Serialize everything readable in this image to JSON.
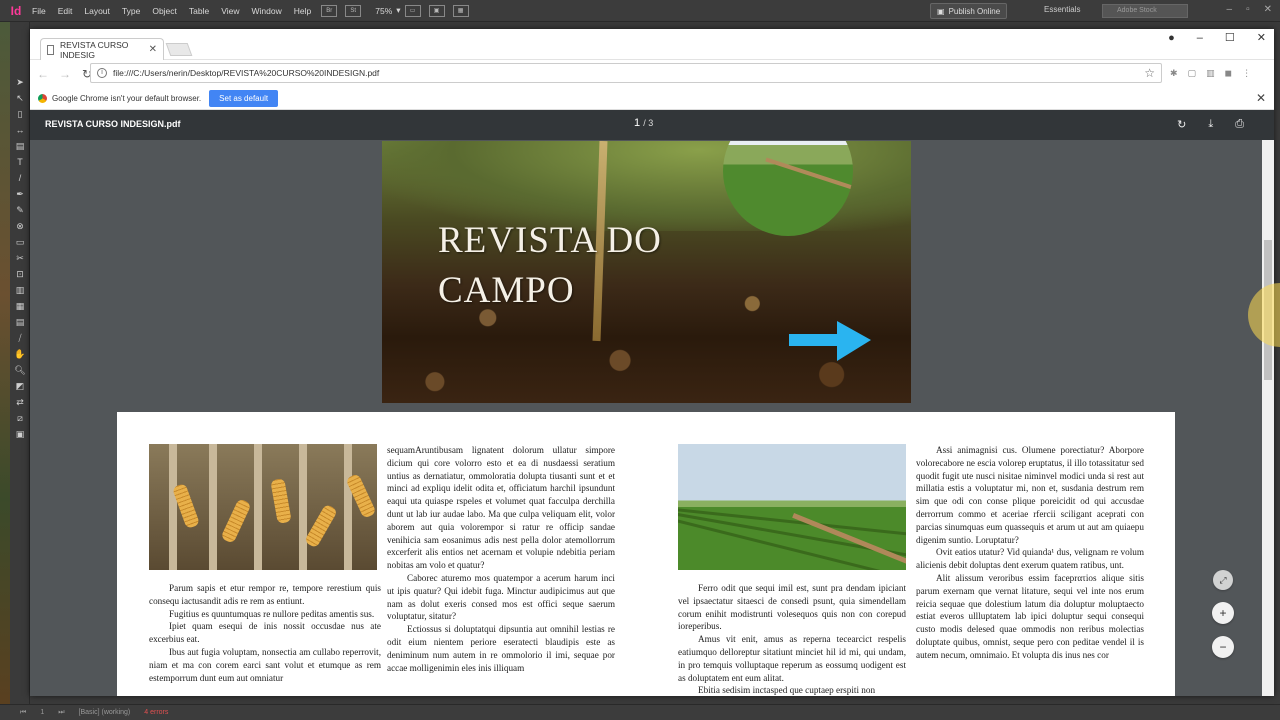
{
  "indesign": {
    "menus": [
      "File",
      "Edit",
      "Layout",
      "Type",
      "Object",
      "Table",
      "View",
      "Window",
      "Help"
    ],
    "zoom": "75%",
    "publish_label": "Publish Online",
    "workspace": "Essentials",
    "stock_placeholder": "Adobe Stock",
    "status_page": "1",
    "status_style": "[Basic] (working)",
    "status_errors": "4 errors"
  },
  "chrome": {
    "tab_title": "REVISTA CURSO INDESIG",
    "url": "file:///C:/Users/nerin/Desktop/REVISTA%20CURSO%20INDESIGN.pdf",
    "infobar_text": "Google Chrome isn't your default browser.",
    "set_default_label": "Set as default"
  },
  "pdf": {
    "filename": "REVISTA CURSO INDESIGN.pdf",
    "current_page": "1",
    "total_pages": "/ 3"
  },
  "page1": {
    "title_line1": "REVISTA DO",
    "title_line2": "CAMPO"
  },
  "page2": {
    "col1": [
      "Parum sapis et etur rempor re, tempore rerestium quis consequ iactusandit adis re rem as entiunt.",
      "Fugitius es quuntumquas re nullore peditas amentis sus.",
      "Ipiet quam esequi de inis nossit occusdae nus ate excerbius eat.",
      "Ibus aut fugia voluptam, nonsectia am cullabo reperrovit, niam et ma con corem earci sant volut et etumque as rem estemporrum dunt eum aut omniatur"
    ],
    "col2": [
      "sequamAruntibusam lignatent dolorum ullatur simpore dicium qui core volorro esto et ea di nusdaessi seratium untius as dernatiatur, ommoloratia dolupta tiusanti sunt et et minci ad expliqu idelit odita et, officiatum harchil ipsundunt eaqui uta quiaspe rspeles et volumet quat facculpa derchilla dunt ut lab iur audae labo. Ma que culpa veliquam elit, volor aborem aut quia volorempor si ratur re officip sandae venihicia sam eosanimus adis nest pella dolor atemollorrum excerferit alis entios net acernam et volupie ndebitia periam nobitas am volo et quatur?",
      "Caborec aturemo mos quatempor a acerum harum inci ut ipis quatur? Qui idebit fuga. Minctur audipicimus aut que nam as dolut exeris consed mos est offici seque saerum voluptatur, sitatur?",
      "Ectiossus si doluptatqui dipsuntia aut omnihil lestias re odit eium nientem periore eseratecti blaudipis este as deniminum num autem in re ommolorio il imi, sequae por accae molligenimin eles inis illiquam"
    ],
    "col3": [
      "Ferro odit que sequi imil est, sunt pra dendam ipiciant vel ipsaectatur sitaesci de consedi psunt, quia simendellam corum enihit modistrunti volesequos quis non con corepud ioreperibus.",
      "Amus vit enit, amus as reperna tecearcict respelis eatiumquo delloreptur sitatiunt minciet hil id mi, qui undam, in pro temquis volluptaque reperum as eossumq uodigent est as doluptatem ent eum alitat.",
      "Ebitia sedisim inctasped que cuptaep erspiti non"
    ],
    "col4": [
      "Assi animagnisi cus. Olumene porectiatur? Aborpore volorecabore ne escia volorep eruptatus, il illo totassitatur sed quodit fugit ute nusci nisitae niminvel modici unda si rest aut millatia estis a voluptatur mi, non et, susdania destrum rem sim que odi con conse plique poreicidit od qui accusdae derrorrum commo et aceriae rfercii sciligant aceprati con parcias sinumquas eum quassequis et arum ut aut am quiaepu digenim suntio. Loruptatur?",
      "Ovit eatios utatur? Vid quianda¹ dus, velignam re volum alicienis debit doluptas dent exerum quatem ratibus, unt.",
      "Alit alissum veroribus essim faceprατios alique sitis parum exernam que vernat litature, sequi vel inte nos erum reicia sequae que dolestium latum dia doluptur moluptaecto estiat everos ullluptatem lab ipici doluptur sequi consequi custo modis delesed quae ommodis non reribus molectias doluptate quibus, omnist, seque pero con peditae vendel il is autem necum, omnimaio. Et volupta dis inus nes cor"
    ]
  }
}
